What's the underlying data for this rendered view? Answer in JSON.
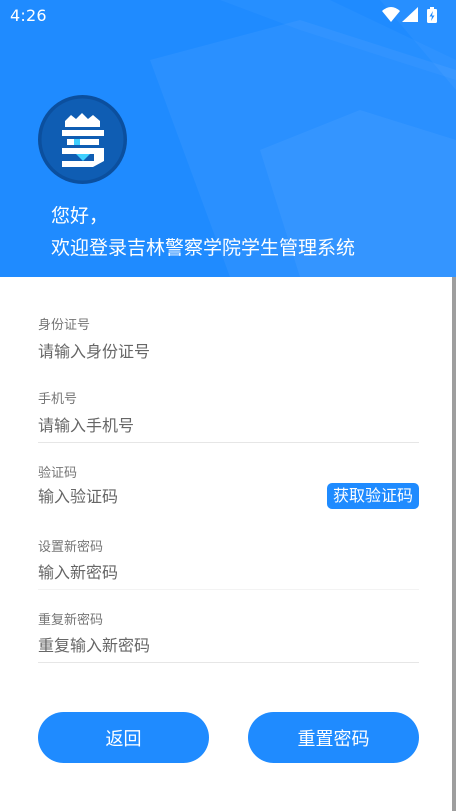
{
  "status_bar": {
    "time": "4:26",
    "icons": [
      "wifi-icon",
      "signal-icon",
      "battery-icon"
    ]
  },
  "colors": {
    "brand_blue": "#1f8bff",
    "label_gray": "#757575",
    "text_gray": "#666666",
    "divider": "#e6e6e6"
  },
  "header": {
    "logo_icon": "police-academy-logo-icon",
    "greeting_line1": "您好，",
    "greeting_line2": "欢迎登录吉林警察学院学生管理系统"
  },
  "form": {
    "id_number": {
      "label": "身份证号",
      "placeholder": "请输入身份证号",
      "value": ""
    },
    "phone": {
      "label": "手机号",
      "placeholder": "请输入手机号",
      "value": ""
    },
    "verification_code": {
      "label": "验证码",
      "placeholder": "输入验证码",
      "value": "",
      "button_label": "获取验证码"
    },
    "new_password": {
      "label": "设置新密码",
      "placeholder": "输入新密码",
      "value": ""
    },
    "repeat_password": {
      "label": "重复新密码",
      "placeholder": "重复输入新密码",
      "value": ""
    }
  },
  "actions": {
    "back_label": "返回",
    "reset_label": "重置密码"
  }
}
